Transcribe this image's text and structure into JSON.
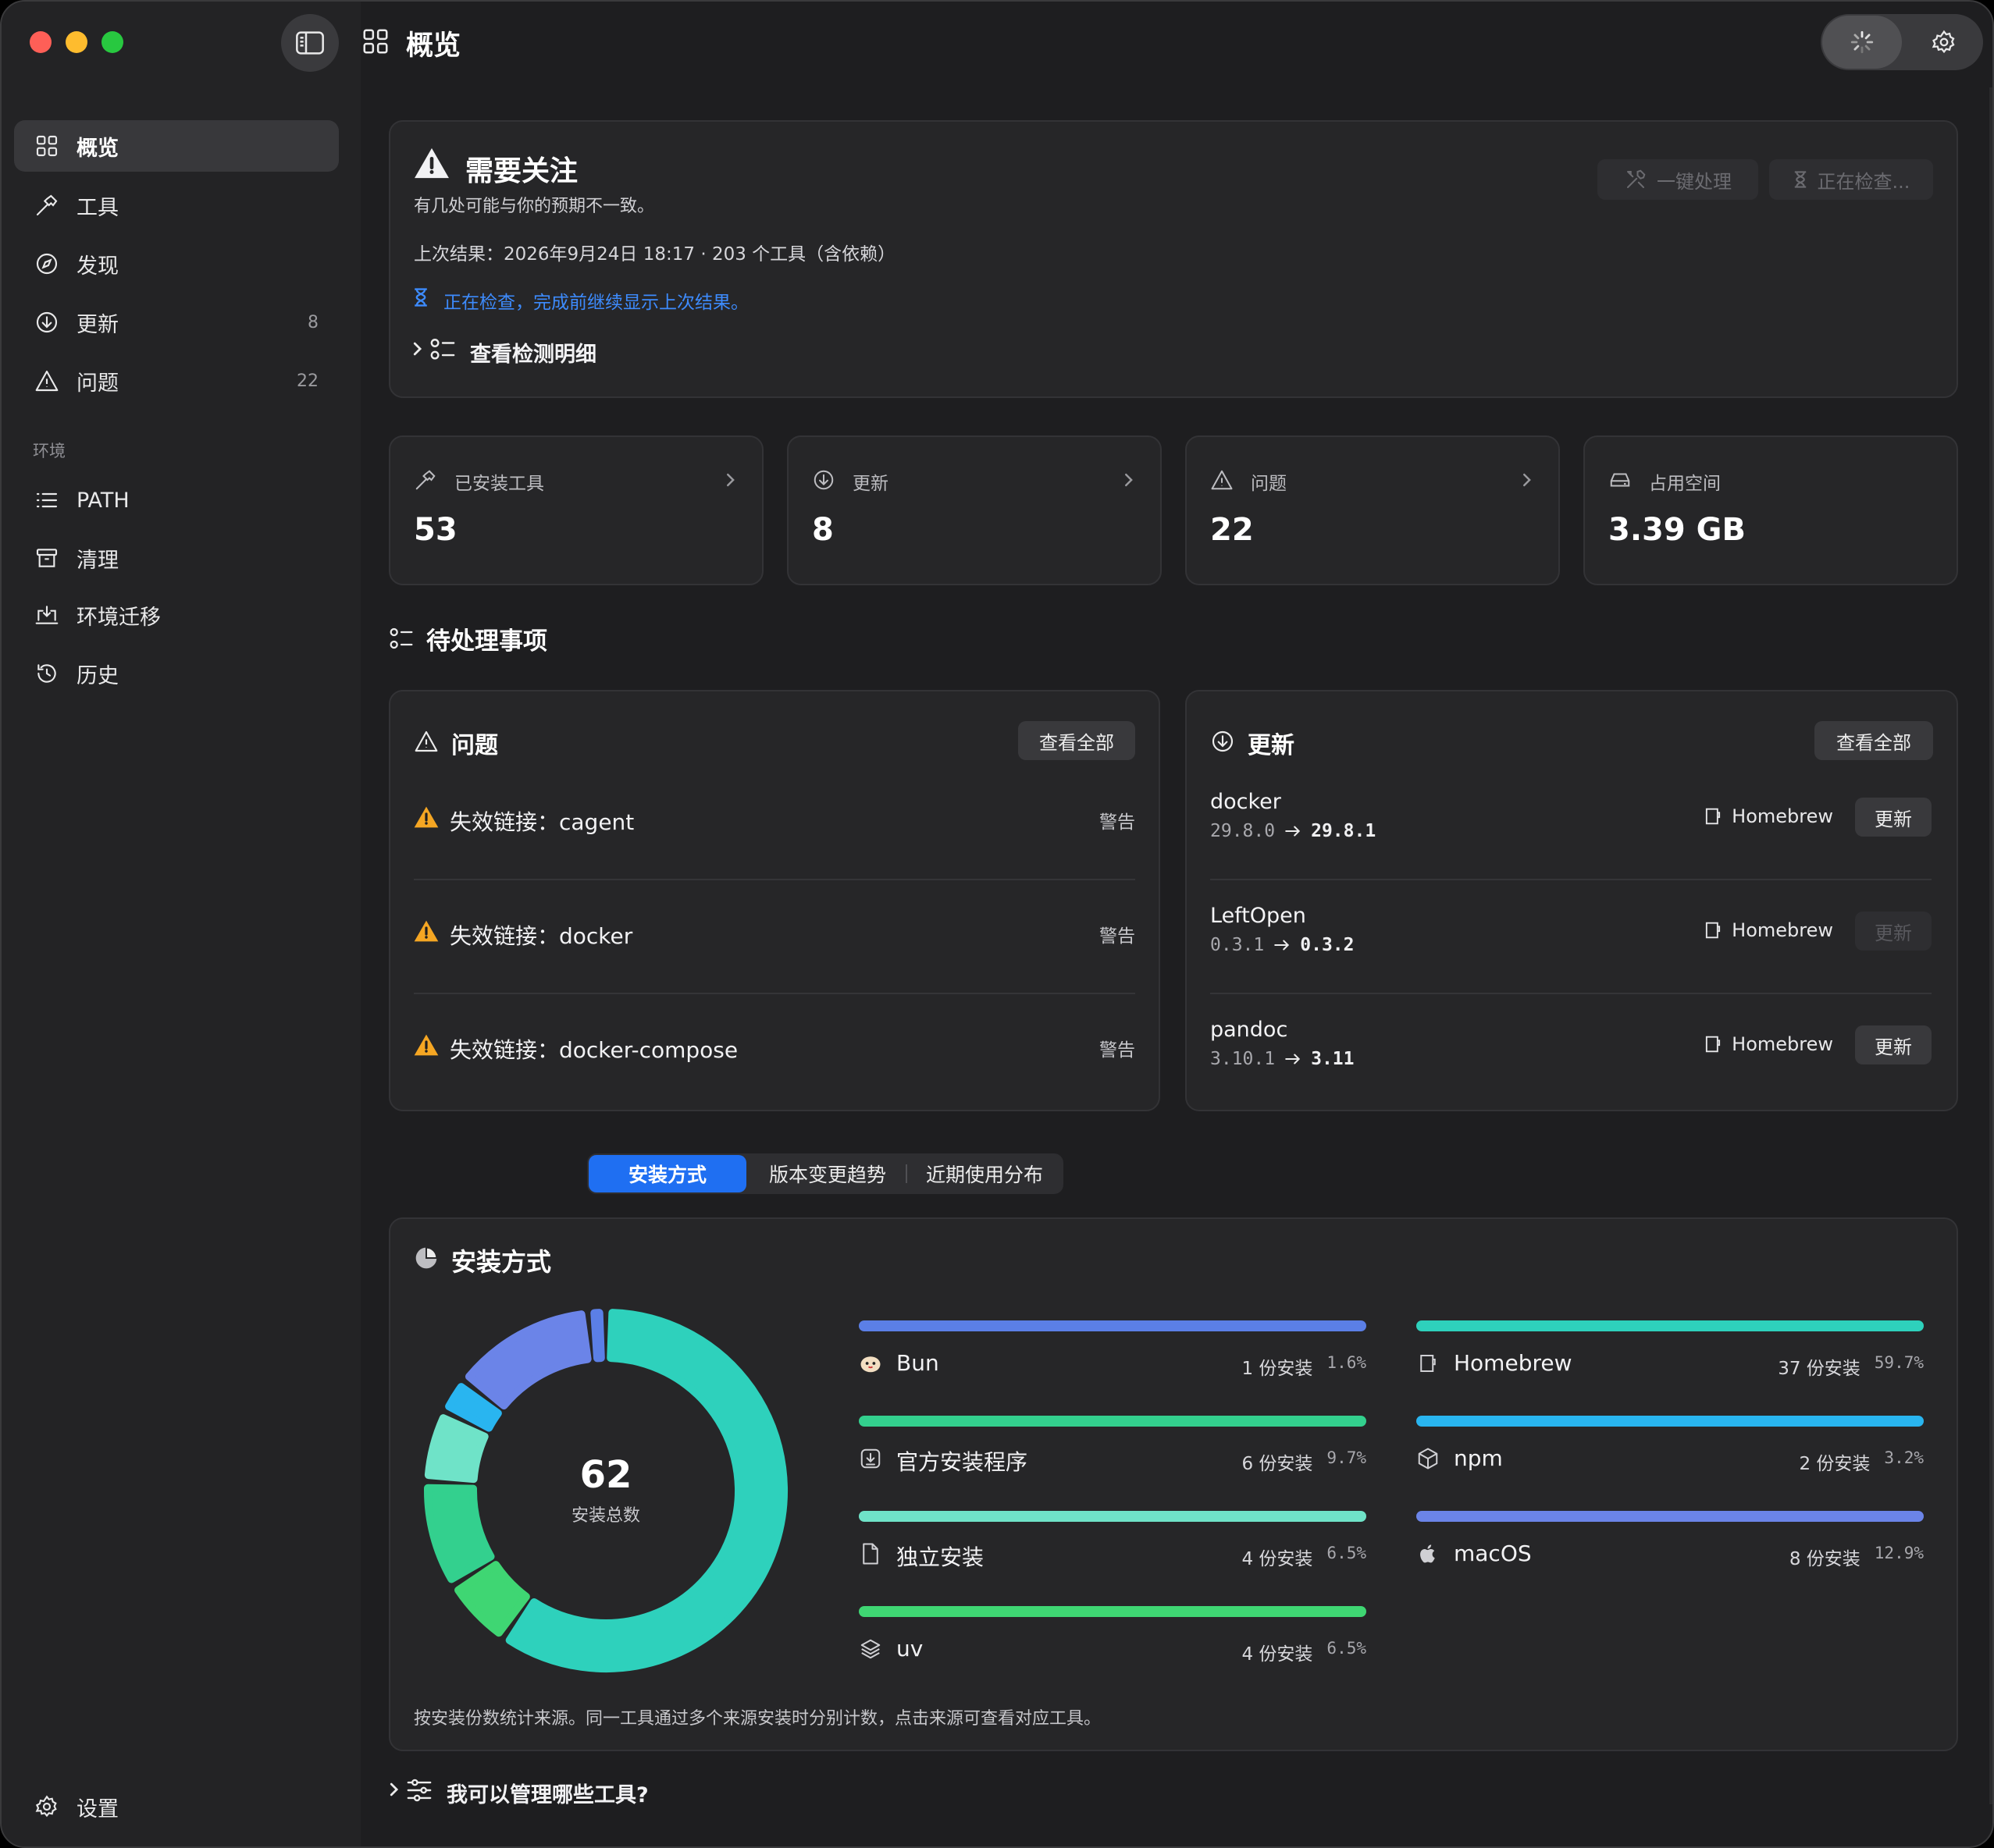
{
  "window": {
    "title": "概览"
  },
  "sidebar": {
    "items": [
      {
        "label": "概览",
        "icon": "grid-icon",
        "active": true
      },
      {
        "label": "工具",
        "icon": "hammer-icon"
      },
      {
        "label": "发现",
        "icon": "compass-icon"
      },
      {
        "label": "更新",
        "icon": "download-circle-icon",
        "count": "8"
      },
      {
        "label": "问题",
        "icon": "warning-triangle-icon",
        "count": "22"
      }
    ],
    "env_section_label": "环境",
    "env_items": [
      {
        "label": "PATH",
        "icon": "list-icon"
      },
      {
        "label": "清理",
        "icon": "archive-box-icon"
      },
      {
        "label": "环境迁移",
        "icon": "laptop-download-icon"
      },
      {
        "label": "历史",
        "icon": "history-clock-icon"
      }
    ],
    "settings_label": "设置"
  },
  "attention": {
    "title": "需要关注",
    "subtitle": "有几处可能与你的预期不一致。",
    "last_result": "上次结果：2026年9月24日 18:17 · 203 个工具（含依赖）",
    "checking_note": "正在检查，完成前继续显示上次结果。",
    "details_label": "查看检测明细",
    "fix_button": "一键处理",
    "checking_button": "正在检查..."
  },
  "stats": [
    {
      "label": "已安装工具",
      "value": "53",
      "icon": "hammer-icon",
      "chevron": true
    },
    {
      "label": "更新",
      "value": "8",
      "icon": "download-circle-icon",
      "chevron": true
    },
    {
      "label": "问题",
      "value": "22",
      "icon": "warning-triangle-icon",
      "chevron": true
    },
    {
      "label": "占用空间",
      "value": "3.39 GB",
      "icon": "drive-icon",
      "chevron": false
    }
  ],
  "pending": {
    "title": "待处理事项",
    "issues": {
      "title": "问题",
      "view_all": "查看全部",
      "rows": [
        {
          "text": "失效链接：cagent",
          "severity": "警告"
        },
        {
          "text": "失效链接：docker",
          "severity": "警告"
        },
        {
          "text": "失效链接：docker-compose",
          "severity": "警告"
        }
      ]
    },
    "updates": {
      "title": "更新",
      "view_all": "查看全部",
      "rows": [
        {
          "name": "docker",
          "from": "29.8.0",
          "to": "29.8.1",
          "source": "Homebrew",
          "button": "更新",
          "enabled": true
        },
        {
          "name": "LeftOpen",
          "from": "0.3.1",
          "to": "0.3.2",
          "source": "Homebrew",
          "button": "更新",
          "enabled": false
        },
        {
          "name": "pandoc",
          "from": "3.10.1",
          "to": "3.11",
          "source": "Homebrew",
          "button": "更新",
          "enabled": true
        }
      ]
    }
  },
  "tabs": {
    "items": [
      "安装方式",
      "版本变更趋势",
      "近期使用分布"
    ],
    "selected": 0
  },
  "install": {
    "title": "安装方式",
    "total": "62",
    "total_label": "安装总数",
    "footnote": "按安装份数统计来源。同一工具通过多个来源安装时分别计数，点击来源可查看对应工具。"
  },
  "chart_data": {
    "type": "pie",
    "center_value": 62,
    "center_label": "安装总数",
    "slices": [
      {
        "name": "Bun",
        "count": 1,
        "count_label": "1 份安装",
        "percent": 1.6,
        "percent_label": "1.6%",
        "color": "#5b7fe6",
        "icon": "bun-icon"
      },
      {
        "name": "官方安装程序",
        "count": 6,
        "count_label": "6 份安装",
        "percent": 9.7,
        "percent_label": "9.7%",
        "color": "#33d08e",
        "icon": "download-box-icon"
      },
      {
        "name": "独立安装",
        "count": 4,
        "count_label": "4 份安装",
        "percent": 6.5,
        "percent_label": "6.5%",
        "color": "#6fe3c8",
        "icon": "document-icon"
      },
      {
        "name": "uv",
        "count": 4,
        "count_label": "4 份安装",
        "percent": 6.5,
        "percent_label": "6.5%",
        "color": "#3fd673",
        "icon": "layers-icon"
      },
      {
        "name": "Homebrew",
        "count": 37,
        "count_label": "37 份安装",
        "percent": 59.7,
        "percent_label": "59.7%",
        "color": "#2ed1bc",
        "icon": "cup-icon"
      },
      {
        "name": "npm",
        "count": 2,
        "count_label": "2 份安装",
        "percent": 3.2,
        "percent_label": "3.2%",
        "color": "#29b5f0",
        "icon": "cube-icon"
      },
      {
        "name": "macOS",
        "count": 8,
        "count_label": "8 份安装",
        "percent": 12.9,
        "percent_label": "12.9%",
        "color": "#6b84e8",
        "icon": "apple-icon"
      }
    ]
  },
  "faq": {
    "label": "我可以管理哪些工具?"
  }
}
